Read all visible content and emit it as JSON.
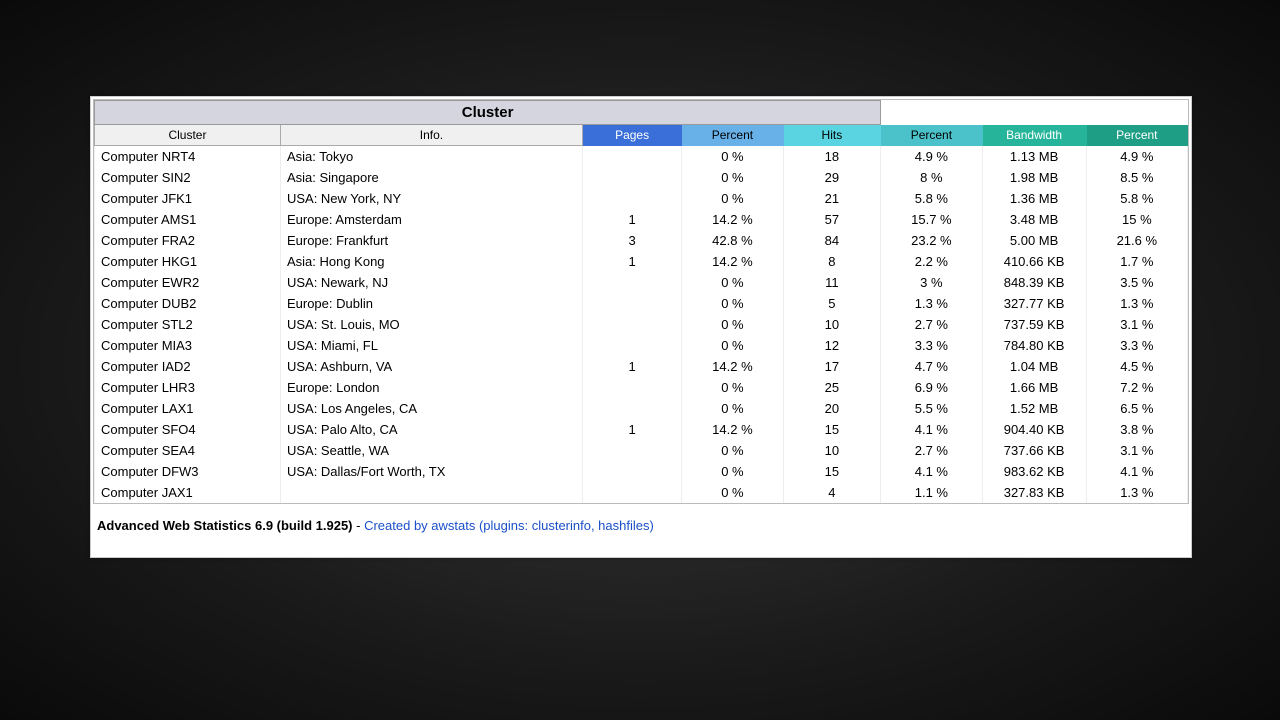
{
  "title": "Cluster",
  "columns": {
    "cluster": "Cluster",
    "info": "Info.",
    "pages": "Pages",
    "pages_pct": "Percent",
    "hits": "Hits",
    "hits_pct": "Percent",
    "bandwidth": "Bandwidth",
    "bandwidth_pct": "Percent"
  },
  "rows": [
    {
      "cluster": "Computer NRT4",
      "info": "Asia: Tokyo",
      "pages": "",
      "pages_pct": "0 %",
      "hits": "18",
      "hits_pct": "4.9 %",
      "bw": "1.13 MB",
      "bw_pct": "4.9 %"
    },
    {
      "cluster": "Computer SIN2",
      "info": "Asia: Singapore",
      "pages": "",
      "pages_pct": "0 %",
      "hits": "29",
      "hits_pct": "8 %",
      "bw": "1.98 MB",
      "bw_pct": "8.5 %"
    },
    {
      "cluster": "Computer JFK1",
      "info": "USA: New York, NY",
      "pages": "",
      "pages_pct": "0 %",
      "hits": "21",
      "hits_pct": "5.8 %",
      "bw": "1.36 MB",
      "bw_pct": "5.8 %"
    },
    {
      "cluster": "Computer AMS1",
      "info": "Europe: Amsterdam",
      "pages": "1",
      "pages_pct": "14.2 %",
      "hits": "57",
      "hits_pct": "15.7 %",
      "bw": "3.48 MB",
      "bw_pct": "15 %"
    },
    {
      "cluster": "Computer FRA2",
      "info": "Europe: Frankfurt",
      "pages": "3",
      "pages_pct": "42.8 %",
      "hits": "84",
      "hits_pct": "23.2 %",
      "bw": "5.00 MB",
      "bw_pct": "21.6 %"
    },
    {
      "cluster": "Computer HKG1",
      "info": "Asia: Hong Kong",
      "pages": "1",
      "pages_pct": "14.2 %",
      "hits": "8",
      "hits_pct": "2.2 %",
      "bw": "410.66 KB",
      "bw_pct": "1.7 %"
    },
    {
      "cluster": "Computer EWR2",
      "info": "USA: Newark, NJ",
      "pages": "",
      "pages_pct": "0 %",
      "hits": "11",
      "hits_pct": "3 %",
      "bw": "848.39 KB",
      "bw_pct": "3.5 %"
    },
    {
      "cluster": "Computer DUB2",
      "info": "Europe: Dublin",
      "pages": "",
      "pages_pct": "0 %",
      "hits": "5",
      "hits_pct": "1.3 %",
      "bw": "327.77 KB",
      "bw_pct": "1.3 %"
    },
    {
      "cluster": "Computer STL2",
      "info": "USA: St. Louis, MO",
      "pages": "",
      "pages_pct": "0 %",
      "hits": "10",
      "hits_pct": "2.7 %",
      "bw": "737.59 KB",
      "bw_pct": "3.1 %"
    },
    {
      "cluster": "Computer MIA3",
      "info": "USA: Miami, FL",
      "pages": "",
      "pages_pct": "0 %",
      "hits": "12",
      "hits_pct": "3.3 %",
      "bw": "784.80 KB",
      "bw_pct": "3.3 %"
    },
    {
      "cluster": "Computer IAD2",
      "info": "USA: Ashburn, VA",
      "pages": "1",
      "pages_pct": "14.2 %",
      "hits": "17",
      "hits_pct": "4.7 %",
      "bw": "1.04 MB",
      "bw_pct": "4.5 %"
    },
    {
      "cluster": "Computer LHR3",
      "info": "Europe: London",
      "pages": "",
      "pages_pct": "0 %",
      "hits": "25",
      "hits_pct": "6.9 %",
      "bw": "1.66 MB",
      "bw_pct": "7.2 %"
    },
    {
      "cluster": "Computer LAX1",
      "info": "USA: Los Angeles, CA",
      "pages": "",
      "pages_pct": "0 %",
      "hits": "20",
      "hits_pct": "5.5 %",
      "bw": "1.52 MB",
      "bw_pct": "6.5 %"
    },
    {
      "cluster": "Computer SFO4",
      "info": "USA: Palo Alto, CA",
      "pages": "1",
      "pages_pct": "14.2 %",
      "hits": "15",
      "hits_pct": "4.1 %",
      "bw": "904.40 KB",
      "bw_pct": "3.8 %"
    },
    {
      "cluster": "Computer SEA4",
      "info": "USA: Seattle, WA",
      "pages": "",
      "pages_pct": "0 %",
      "hits": "10",
      "hits_pct": "2.7 %",
      "bw": "737.66 KB",
      "bw_pct": "3.1 %"
    },
    {
      "cluster": "Computer DFW3",
      "info": "USA: Dallas/Fort Worth, TX",
      "pages": "",
      "pages_pct": "0 %",
      "hits": "15",
      "hits_pct": "4.1 %",
      "bw": "983.62 KB",
      "bw_pct": "4.1 %"
    },
    {
      "cluster": "Computer JAX1",
      "info": "",
      "pages": "",
      "pages_pct": "0 %",
      "hits": "4",
      "hits_pct": "1.1 %",
      "bw": "327.83 KB",
      "bw_pct": "1.3 %"
    }
  ],
  "footer": {
    "product": "Advanced Web Statistics 6.9 (build 1.925)",
    "sep": " - ",
    "link_text": "Created by awstats (plugins: clusterinfo, hashfiles)"
  }
}
